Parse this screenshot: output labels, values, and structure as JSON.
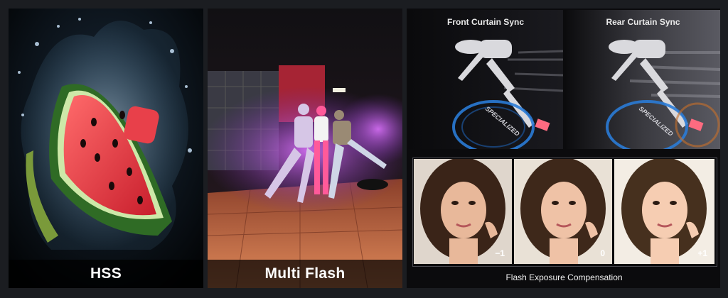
{
  "panels": {
    "hss": {
      "label": "HSS"
    },
    "multi_flash": {
      "label": "Multi Flash"
    },
    "sync": {
      "front_label": "Front Curtain Sync",
      "rear_label": "Rear Curtain Sync",
      "bike_text": "SPECIALIZED"
    },
    "fec": {
      "caption": "Flash Exposure Compensation",
      "steps": [
        "−1",
        "0",
        "+1"
      ]
    }
  },
  "colors": {
    "background": "#1b1d21",
    "caption_bar": "#000000",
    "haze_purple": "#b24bd6",
    "neon_red": "#c0283a",
    "melon_red": "#e8404a",
    "rind_green": "#2f6b25"
  }
}
